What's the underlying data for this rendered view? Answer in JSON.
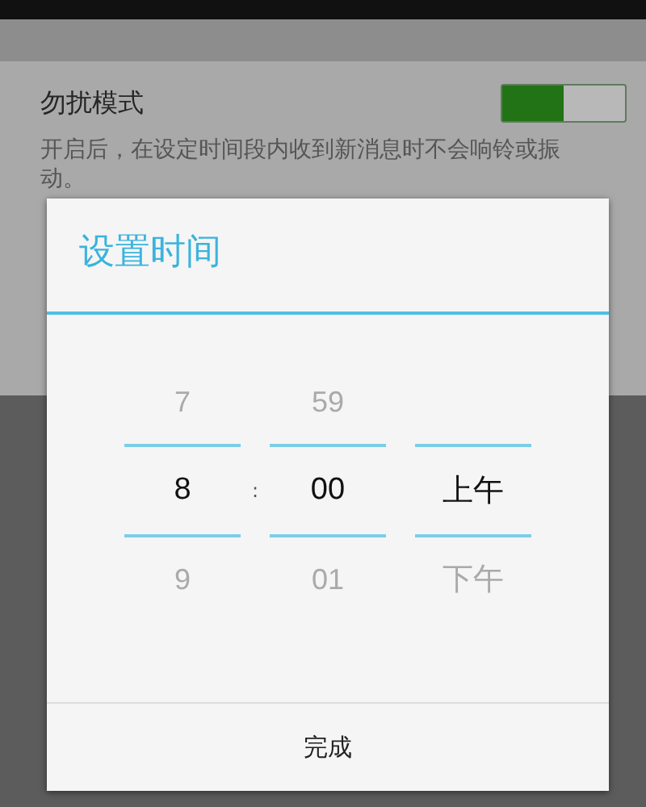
{
  "setting": {
    "title": "勿扰模式",
    "description": "开启后，在设定时间段内收到新消息时不会响铃或振动。",
    "toggle": {
      "on": true
    }
  },
  "dialog": {
    "title": "设置时间",
    "columns": [
      {
        "kind": "hour",
        "items": [
          {
            "text": "7",
            "selected": false
          },
          {
            "text": "8",
            "selected": true
          },
          {
            "text": "9",
            "selected": false
          }
        ]
      },
      {
        "kind": "minute",
        "items": [
          {
            "text": "59",
            "selected": false
          },
          {
            "text": "00",
            "selected": true
          },
          {
            "text": "01",
            "selected": false
          }
        ]
      },
      {
        "kind": "period",
        "items": [
          {
            "text": "上午",
            "selected": true
          },
          {
            "text": "下午",
            "selected": false
          }
        ]
      }
    ],
    "separator": ":",
    "button": "完成"
  }
}
